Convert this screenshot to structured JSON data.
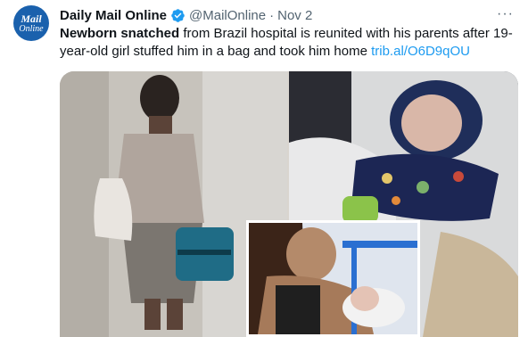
{
  "account": {
    "avatar_line1": "Mail",
    "avatar_line2": "Online",
    "name": "Daily Mail Online",
    "handle": "@MailOnline",
    "separator": "·",
    "date": "Nov 2"
  },
  "tweet": {
    "bold_text": "Newborn snatched",
    "text": " from Brazil hospital is reunited with his parents after 19-year-old girl stuffed him in a bag and took him home ",
    "link": "trib.al/O6D9qOU"
  },
  "ui": {
    "more_label": "···"
  },
  "colors": {
    "avatar_bg": "#1a61ad",
    "link": "#1d9bf0",
    "verified_badge": "#1d9bf0",
    "muted": "#536471"
  },
  "icons": {
    "verified": "verified-badge-icon",
    "more": "more-options-icon"
  }
}
